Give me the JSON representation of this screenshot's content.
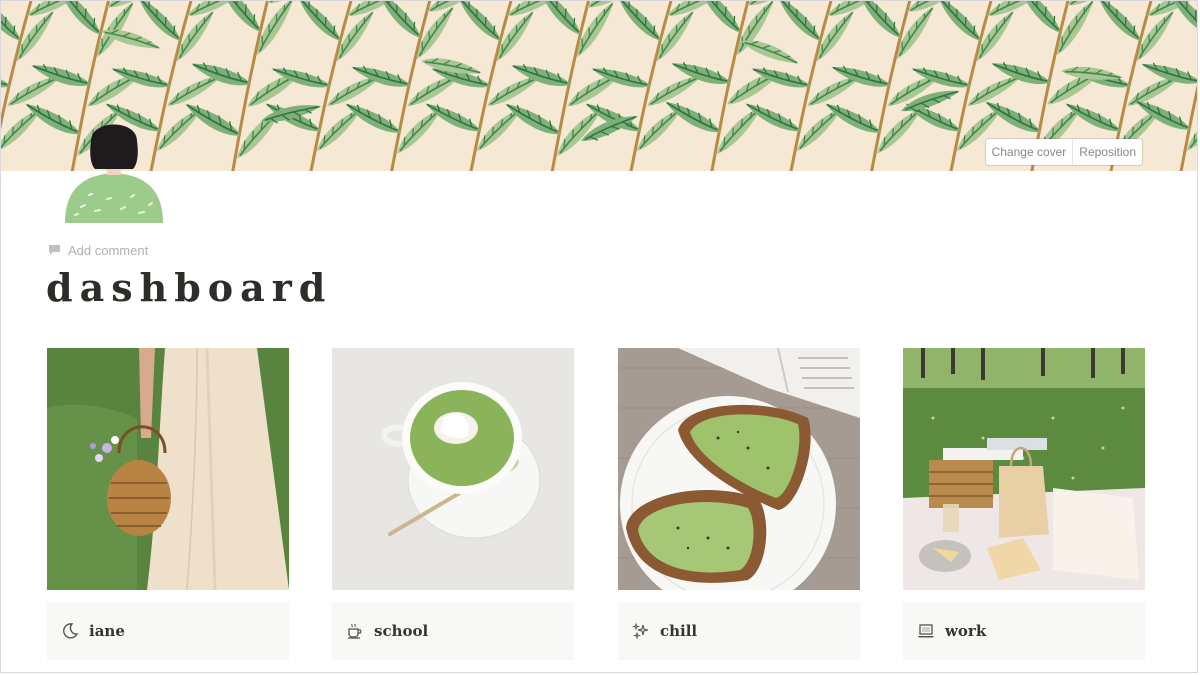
{
  "cover": {
    "change_cover_label": "Change cover",
    "reposition_label": "Reposition",
    "colors": {
      "background": "#f5e8d5",
      "leaf_light": "#a9c694",
      "leaf_dark": "#3f8a4c",
      "stem": "#b98a45"
    }
  },
  "page": {
    "icon": "girl-avatar-icon",
    "add_comment_label": "Add comment",
    "title": "dashboard"
  },
  "gallery": {
    "cards": [
      {
        "label": "iane",
        "icon": "crescent-moon-icon"
      },
      {
        "label": "school",
        "icon": "coffee-cup-icon"
      },
      {
        "label": "chill",
        "icon": "sparkles-icon"
      },
      {
        "label": "work",
        "icon": "laptop-icon"
      }
    ]
  }
}
